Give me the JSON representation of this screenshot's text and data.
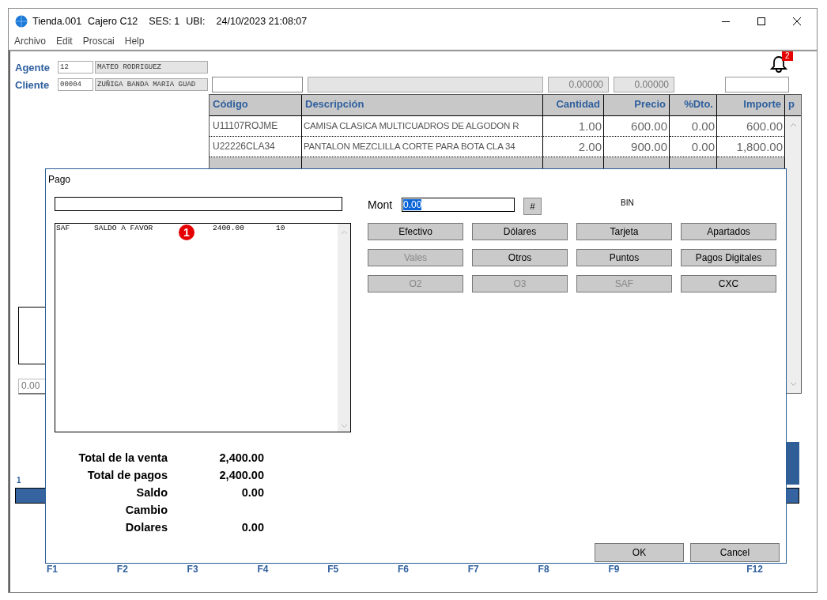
{
  "window": {
    "title_parts": [
      "Tienda.001",
      "Cajero C12",
      "SES: 1",
      "UBI:",
      "24/10/2023 21:08:07"
    ]
  },
  "menu": [
    "Archivo",
    "Edit",
    "Proscai",
    "Help"
  ],
  "notifications": {
    "count": "2"
  },
  "agente": {
    "label": "Agente",
    "code": "12",
    "name": "MATEO RODRIGUEZ"
  },
  "cliente": {
    "label": "Cliente",
    "code": "00004",
    "name": "ZUÑIGA BANDA MARIA GUAD",
    "amounts": [
      "0.00000",
      "0.00000"
    ]
  },
  "table": {
    "columns": [
      "Código",
      "Descripción",
      "Cantidad",
      "Precio",
      "%Dto.",
      "Importe",
      "p"
    ],
    "rows": [
      [
        "U11107ROJME",
        "CAMISA CLASICA MULTICUADROS DE ALGODON R",
        "1.00",
        "600.00",
        "0.00",
        "600.00"
      ],
      [
        "U22226CLA34",
        "PANTALON MEZCLILLA CORTE  PARA BOTA CLA 34",
        "2.00",
        "900.00",
        "0.00",
        "1,800.00"
      ]
    ]
  },
  "left_panel": {
    "amount": "0.00",
    "counter": "1"
  },
  "function_keys": [
    "F1",
    "F2",
    "F3",
    "F4",
    "F5",
    "F6",
    "F7",
    "F8",
    "F9",
    "F12"
  ],
  "dialog": {
    "title": "Pago",
    "payments": [
      {
        "code": "SAF",
        "description": "SALDO A FAVOR",
        "marker": "1",
        "amount": "2400.00",
        "count": "10"
      }
    ],
    "amount_label": "Mont",
    "amount_value": "0.00",
    "amount_selected": true,
    "hash_button": "#",
    "bin_label": "BIN",
    "payment_buttons": [
      {
        "label": "Efectivo",
        "disabled": false
      },
      {
        "label": "Dólares",
        "disabled": false
      },
      {
        "label": "Tarjeta",
        "disabled": false
      },
      {
        "label": "Apartados",
        "disabled": false
      },
      {
        "label": "Vales",
        "disabled": true
      },
      {
        "label": "Otros",
        "disabled": false
      },
      {
        "label": "Puntos",
        "disabled": false
      },
      {
        "label": "Pagos Digitales",
        "disabled": false
      },
      {
        "label": "O2",
        "disabled": true
      },
      {
        "label": "O3",
        "disabled": true
      },
      {
        "label": "SAF",
        "disabled": true
      },
      {
        "label": "CXC",
        "disabled": false
      }
    ],
    "totals": [
      {
        "label": "Total de la venta",
        "value": "2,400.00"
      },
      {
        "label": "Total de pagos",
        "value": "2,400.00"
      },
      {
        "label": "Saldo",
        "value": "0.00"
      },
      {
        "label": "Cambio"
      },
      {
        "label": "Dolares",
        "value": "0.00"
      }
    ],
    "buttons": [
      "OK",
      "Cancel"
    ]
  }
}
